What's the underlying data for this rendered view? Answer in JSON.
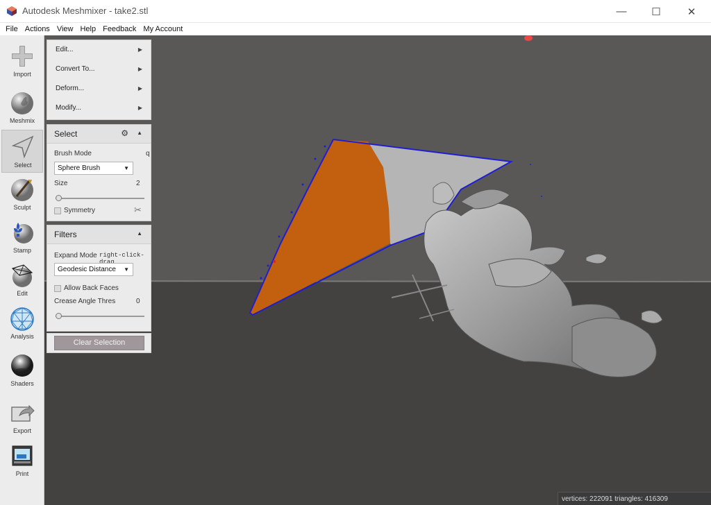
{
  "window": {
    "title": "Autodesk Meshmixer - take2.stl",
    "minimize_glyph": "—",
    "maximize_glyph": "☐",
    "close_glyph": "✕"
  },
  "menubar": [
    "File",
    "Actions",
    "View",
    "Help",
    "Feedback",
    "My Account"
  ],
  "toolbar": {
    "items": [
      {
        "label": "Import",
        "icon": "plus-icon"
      },
      {
        "label": "Meshmix",
        "icon": "bunny-sphere-icon"
      },
      {
        "label": "Select",
        "icon": "arrow-cursor-icon"
      },
      {
        "label": "Sculpt",
        "icon": "brush-icon"
      },
      {
        "label": "Stamp",
        "icon": "fleur-stamp-icon"
      },
      {
        "label": "Edit",
        "icon": "wireframe-sphere-icon"
      },
      {
        "label": "Analysis",
        "icon": "mesh-sphere-icon"
      },
      {
        "label": "Shaders",
        "icon": "chrome-sphere-icon"
      },
      {
        "label": "Export",
        "icon": "export-folder-icon"
      },
      {
        "label": "Print",
        "icon": "printer-icon"
      }
    ],
    "active": "Select"
  },
  "action_menu": {
    "items": [
      {
        "label": "Edit..."
      },
      {
        "label": "Convert To..."
      },
      {
        "label": "Deform..."
      },
      {
        "label": "Modify..."
      }
    ],
    "arrow": "▶"
  },
  "select_panel": {
    "title": "Select",
    "collapse": "▲",
    "gear": "⚙",
    "brush_mode_label": "Brush Mode",
    "brush_mode_hotkey": "q",
    "brush_mode_value": "Sphere Brush",
    "size_label": "Size",
    "size_value": "2",
    "size_fraction": 0.0,
    "symmetry_label": "Symmetry",
    "symmetry_checked": false,
    "wrench": "✂"
  },
  "filters_panel": {
    "title": "Filters",
    "collapse": "▲",
    "expand_mode_label": "Expand Mode",
    "expand_mode_hint": "right-click-drag",
    "expand_mode_value": "Geodesic Distance",
    "allow_back_faces_label": "Allow Back Faces",
    "allow_back_faces_checked": false,
    "crease_angle_label": "Crease Angle Thres",
    "crease_angle_value": "0",
    "crease_fraction": 0.0
  },
  "clear_selection_label": "Clear Selection",
  "dropdown_arrow": "▼",
  "viewport": {
    "stats": "vertices: 222091 triangles: 416309",
    "colors": {
      "background_top": "#5a5857",
      "background_bottom": "#444241",
      "selection": "#c2600f",
      "boundary": "#1f1fcf",
      "mesh": "#a8a8a8"
    }
  }
}
